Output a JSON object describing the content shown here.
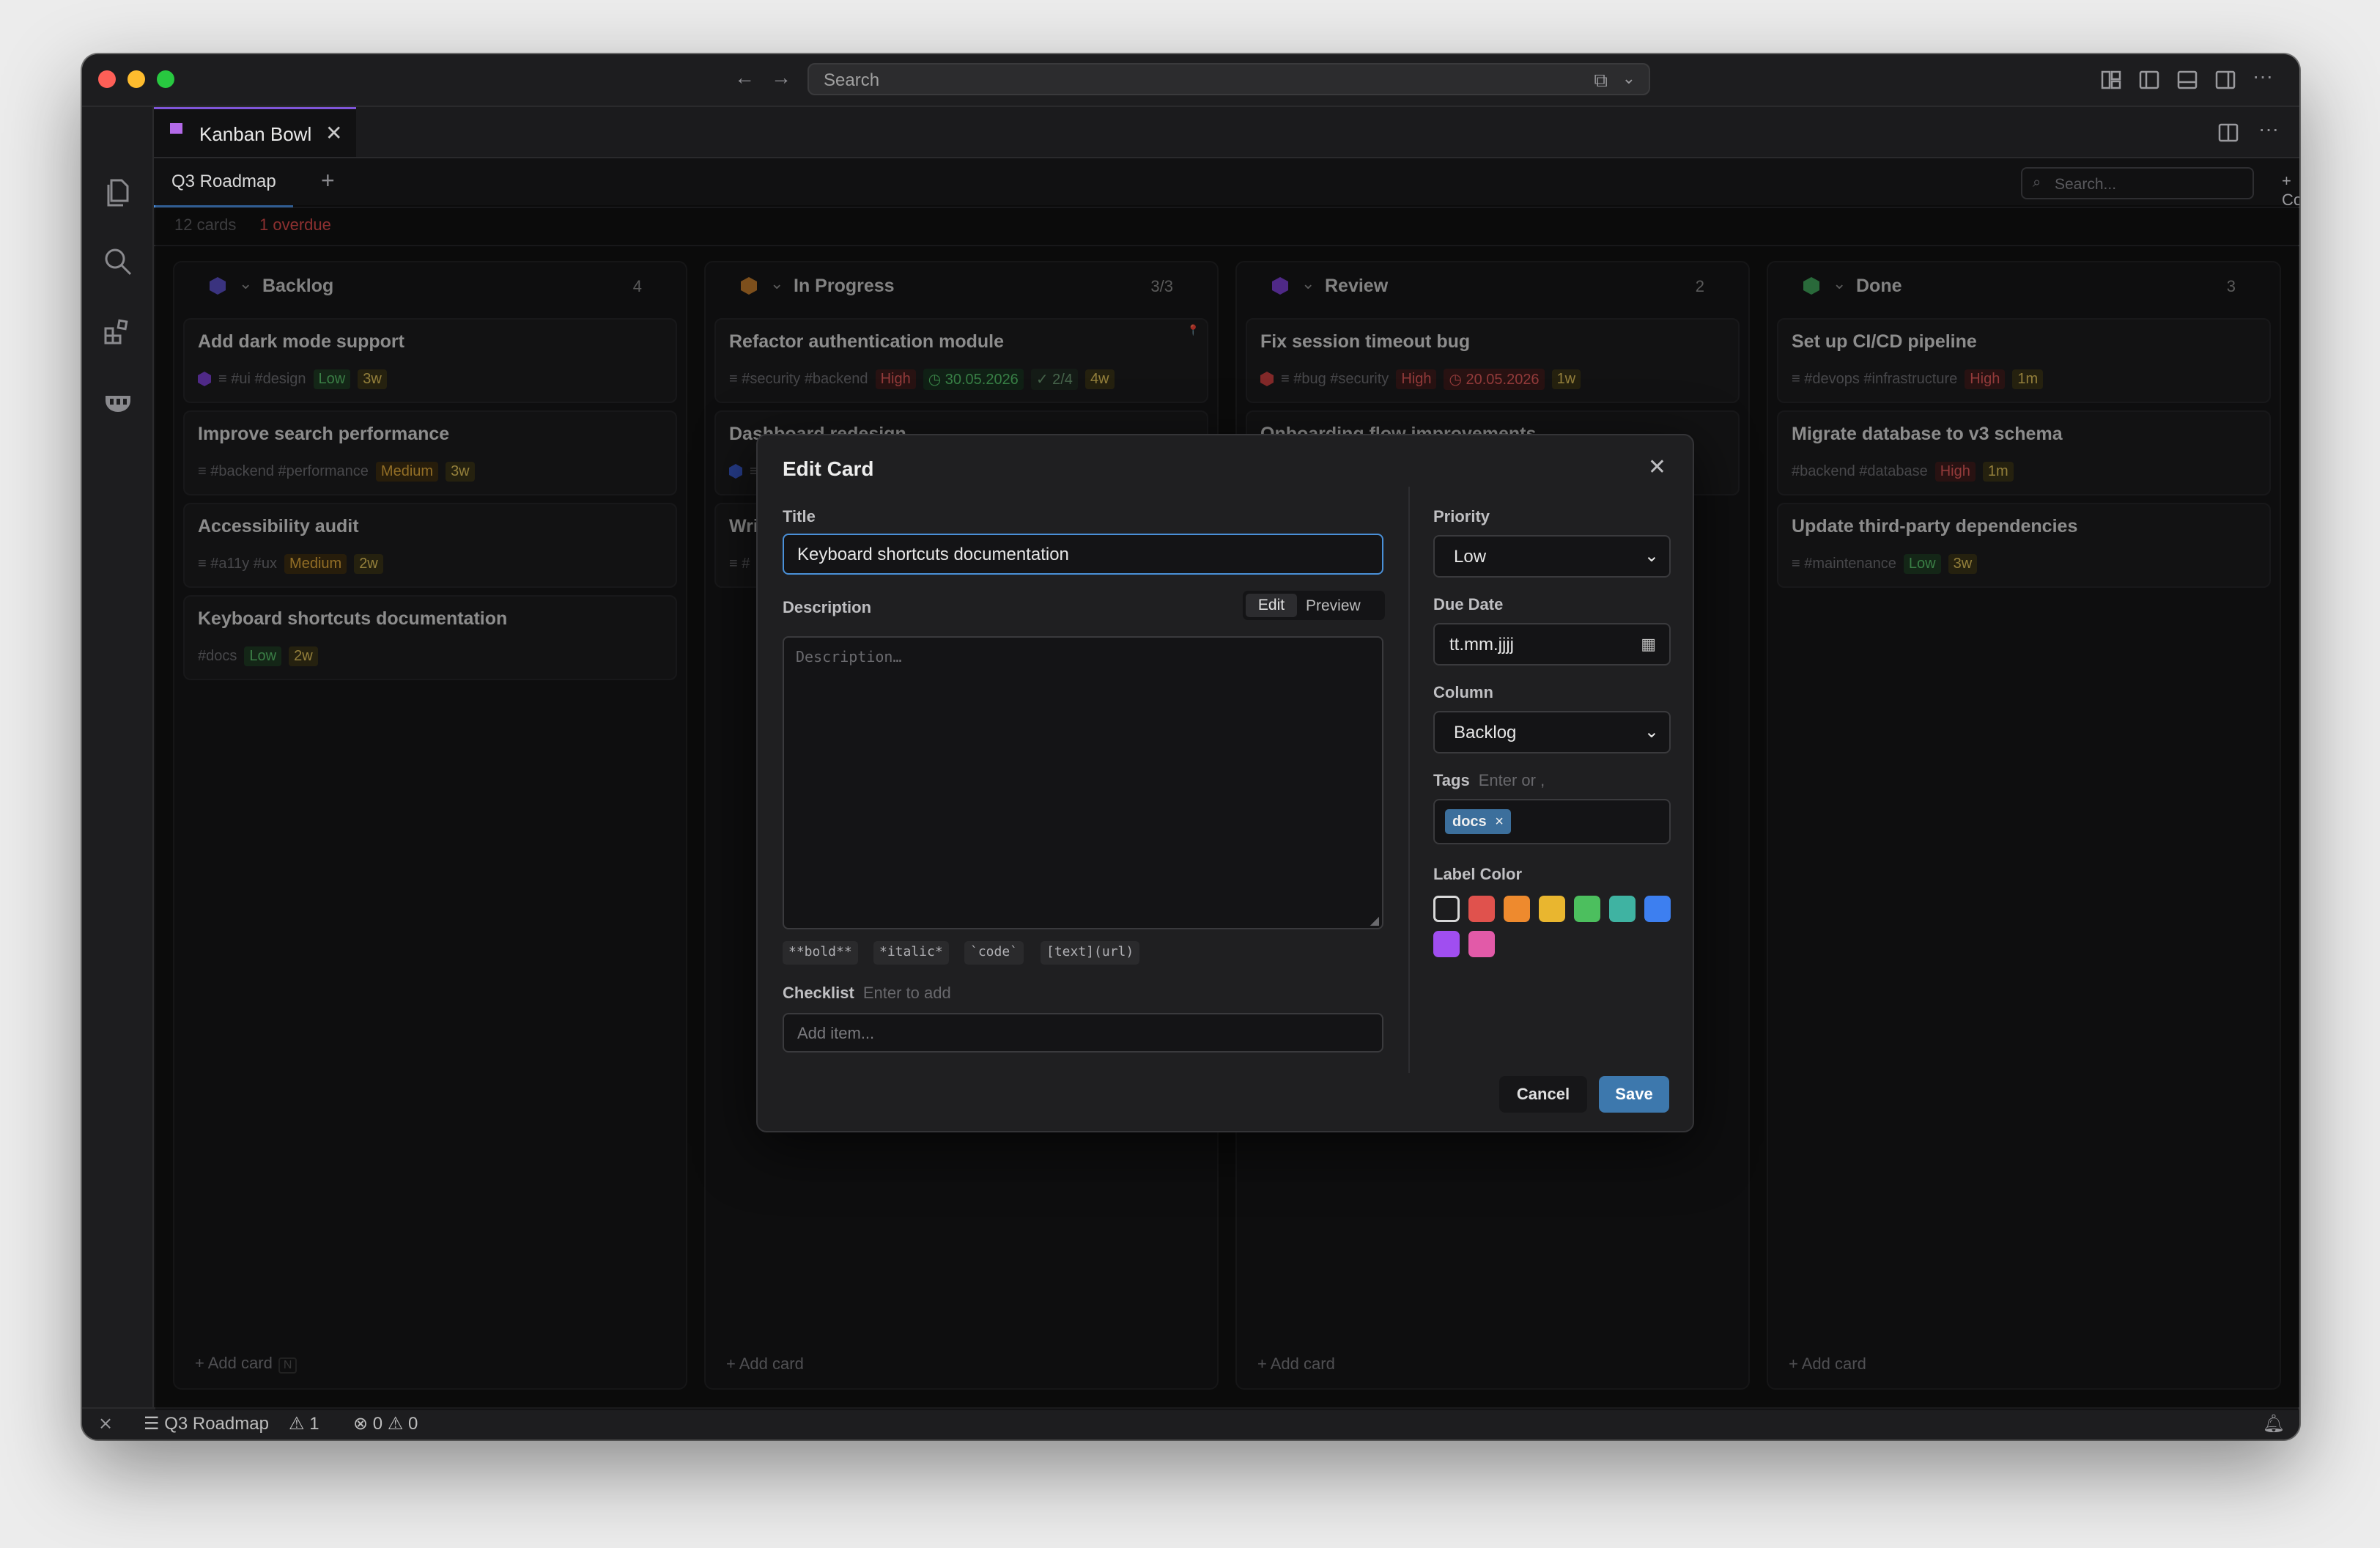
{
  "titlebar": {
    "search_placeholder": "Search"
  },
  "tab": {
    "label": "Kanban Bowl"
  },
  "board": {
    "name": "Q3 Roadmap",
    "add_board_label": "+",
    "search_placeholder": "Search...",
    "add_column_label": "+ Column",
    "cards_count": "12 cards",
    "overdue": "1 overdue"
  },
  "columns": [
    {
      "title": "Backlog",
      "count": "4",
      "color": "#5a4fc4",
      "add_label": "+ Add card",
      "add_hint": "N",
      "cards": [
        {
          "title": "Add dark mode support",
          "hex": "#7a3fd0",
          "tags": "≡  #ui  #design",
          "priority": "Low",
          "age": "3w"
        },
        {
          "title": "Improve search performance",
          "tags": "≡  #backend  #performance",
          "priority": "Medium",
          "age": "3w"
        },
        {
          "title": "Accessibility audit",
          "tags": "≡  #a11y  #ux",
          "priority": "Medium",
          "age": "2w"
        },
        {
          "title": "Keyboard shortcuts documentation",
          "tags": "#docs",
          "priority": "Low",
          "age": "2w"
        }
      ]
    },
    {
      "title": "In Progress",
      "count": "3/3",
      "color": "#c07a2c",
      "add_label": "+ Add card",
      "cards": [
        {
          "title": "Refactor authentication module",
          "tags": "≡  #security  #backend",
          "priority": "High",
          "date": "◷ 30.05.2026",
          "check": "✓ 2/4",
          "age": "4w",
          "pin": "📍"
        },
        {
          "title": "Dashboard redesign",
          "hex": "#3a5bd0",
          "tags": "≡"
        },
        {
          "title": "Write API docs",
          "tags": "≡  #"
        }
      ]
    },
    {
      "title": "Review",
      "count": "2",
      "color": "#7a3fd0",
      "add_label": "+ Add card",
      "cards": [
        {
          "title": "Fix session timeout bug",
          "hex": "#c84040",
          "tags": "≡  #bug  #security",
          "priority": "High",
          "date": "◷ 20.05.2026",
          "age": "1w"
        },
        {
          "title": "Onboarding flow improvements"
        }
      ]
    },
    {
      "title": "Done",
      "count": "3",
      "color": "#3fa25a",
      "add_label": "+ Add card",
      "cards": [
        {
          "title": "Set up CI/CD pipeline",
          "tags": "≡  #devops  #infrastructure",
          "priority": "High",
          "age": "1m"
        },
        {
          "title": "Migrate database to v3 schema",
          "tags": "#backend  #database",
          "priority": "High",
          "age": "1m"
        },
        {
          "title": "Update third-party dependencies",
          "tags": "≡  #maintenance",
          "priority": "Low",
          "age": "3w"
        }
      ]
    }
  ],
  "modal": {
    "title": "Edit Card",
    "title_label": "Title",
    "title_value": "Keyboard shortcuts documentation",
    "description_label": "Description",
    "edit_tab": "Edit",
    "preview_tab": "Preview",
    "description_placeholder": "Description…",
    "format_hints": [
      "**bold**",
      "*italic*",
      "`code`",
      "[text](url)"
    ],
    "checklist_label": "Checklist",
    "checklist_hint": "Enter to add",
    "checklist_placeholder": "Add item...",
    "priority_label": "Priority",
    "priority_value": "Low",
    "due_label": "Due Date",
    "due_value": "tt.mm.jjjj",
    "column_label": "Column",
    "column_value": "Backlog",
    "tags_label": "Tags",
    "tags_hint": "Enter or ,",
    "tag_chip": "docs",
    "label_color_label": "Label Color",
    "colors": [
      "#1c1c1e",
      "#e0524d",
      "#ee8a2e",
      "#e9b62f",
      "#4cbf5e",
      "#3fb3a2",
      "#3d7ff0",
      "#a04ef0",
      "#e25aa8"
    ],
    "cancel_label": "Cancel",
    "save_label": "Save"
  },
  "statusbar": {
    "board": "Q3 Roadmap",
    "warnings": "1",
    "errors": "0",
    "warnings2": "0"
  }
}
